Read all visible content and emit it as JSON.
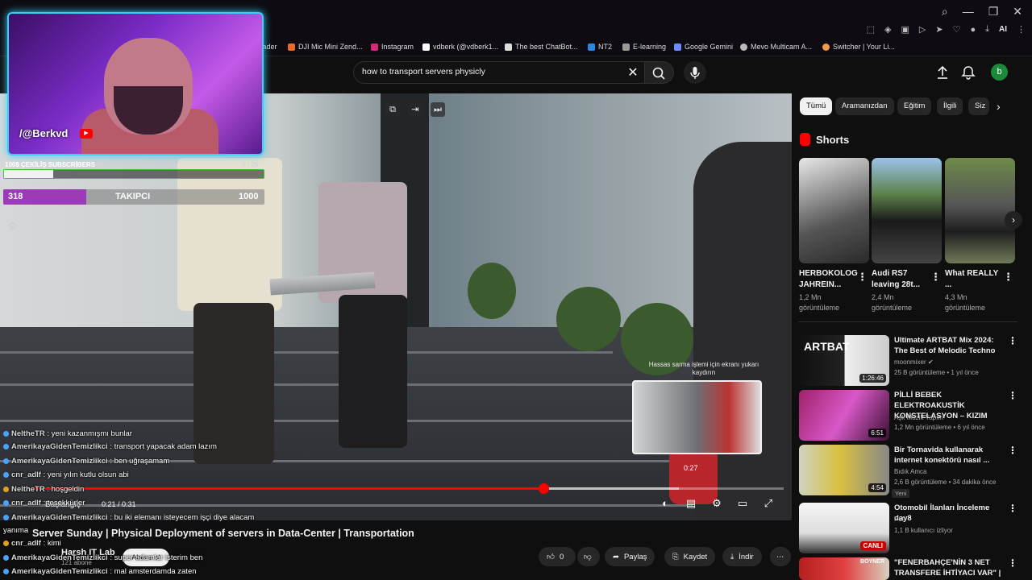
{
  "bookmarks": [
    "...ader",
    "DJI Mic Mini Zend...",
    "Instagram",
    "vdberk (@vdberk1...",
    "The best ChatBot...",
    "NT2",
    "E-learning",
    "Google Gemini",
    "Mevo Multicam A...",
    "Switcher | Your Li..."
  ],
  "toolbar": {
    "ai_label": "AI"
  },
  "search": {
    "query": "how to transport servers physicly"
  },
  "header": {
    "avatar_letter": "b"
  },
  "player": {
    "chapter": "Başlangıç",
    "time": "0:21 / 0:31",
    "progress": 0.68,
    "hover_position": 0.86,
    "preview_hint": "Hassas sarma işlemi için ekranı yukarı kaydırın",
    "preview_time": "0:27"
  },
  "video": {
    "title": "Server Sunday | Physical Deployment of servers in Data-Center | Transportation",
    "channel": "Harsh IT Lab",
    "subscribers": "121 abone",
    "subscribe_label": "Abone ol",
    "likes": "0",
    "share_label": "Paylaş",
    "save_label": "Kaydet",
    "download_label": "İndir"
  },
  "sidebar": {
    "chips": [
      "Tümü",
      "Aramanızdan",
      "Eğitim",
      "İlgili",
      "Siz"
    ],
    "shorts_title": "Shorts",
    "shorts": [
      {
        "title": "HERBOKOLOG JAHREIN...",
        "views": "1,2 Mn görüntüleme"
      },
      {
        "title": "Audi RS7 leaving 28t...",
        "views": "2,4 Mn görüntüleme"
      },
      {
        "title": "What REALLY ...",
        "views": "4,3 Mn görüntüleme"
      }
    ],
    "recommendations": [
      {
        "title": "Ultimate ARTBAT Mix 2024: The Best of Melodic Techno",
        "channel": "moonmixer",
        "meta": "25 B görüntüleme • 1 yıl önce",
        "duration": "1:26:46",
        "thumb_text": "ARTBAT"
      },
      {
        "title": "PİLLİ BEBEK ELEKTROAKUSTİK KONSTELASYON – KIZIM",
        "channel": "Aşk Müzik Yapım",
        "meta": "1,2 Mn görüntüleme • 6 yıl önce",
        "duration": "6:51"
      },
      {
        "title": "Bir Tornavida kullanarak internet konektörü nasıl ...",
        "channel": "Bıdık Amca",
        "meta": "2,6 B görüntüleme • 34 dakika önce",
        "duration": "4:54",
        "badge": "Yeni"
      },
      {
        "title": "Otomobil İlanları İnceleme day8",
        "channel": "Pufi",
        "meta": "1,1 B kullanıcı izliyor",
        "live": "CANLI"
      },
      {
        "title": "\"FENERBAHÇE'NİN 3 NET TRANSFERE İHTİYACI VAR\" | ...",
        "thumb_text": "BOYNER"
      }
    ]
  },
  "overlay": {
    "handle": "/@Berkvd",
    "goal_label": "100$ ÇEKİLİŞ SUBSCRİBERS",
    "goal_count": "5 / 26",
    "goal_progress": 0.19,
    "follow_current": "318",
    "follow_label": "TAKIPCI",
    "follow_target": "1000",
    "follow_progress": 0.318
  },
  "chat": [
    {
      "user": "NeltheTR",
      "text": "yeni kazanmışmı bunlar",
      "color": "#4aa3ff"
    },
    {
      "user": "AmerikayaGidenTemizlikci",
      "text": "transport yapacak adam lazım",
      "color": "#4aa3ff"
    },
    {
      "user": "AmerikayaGidenTemizlikci",
      "text": "ben uğraşamam",
      "color": "#4aa3ff"
    },
    {
      "user": "cnr_adlf",
      "text": "yeni yılın kutlu olsun abi",
      "color": "#4aa3ff"
    },
    {
      "user": "NeltheTR",
      "text": "hoşgeldin",
      "color": "#e0a020"
    },
    {
      "user": "cnr_adlf",
      "text": "teşekkürler",
      "color": "#4aa3ff"
    },
    {
      "user": "AmerikayaGidenTemizlikci",
      "text": "bu iki elemanı isteyecem işçi diye alacam",
      "color": "#4aa3ff"
    },
    {
      "user": "",
      "text": "yanıma",
      "color": ""
    },
    {
      "user": "cnr_adlf",
      "text": "kimi",
      "color": "#e0a020"
    },
    {
      "user": "AmerikayaGidenTemizlikci",
      "text": "super adamlar isterim ben",
      "color": "#4aa3ff"
    },
    {
      "user": "AmerikayaGidenTemizlikci",
      "text": "mal amsterdamda zaten",
      "color": "#4aa3ff"
    }
  ]
}
